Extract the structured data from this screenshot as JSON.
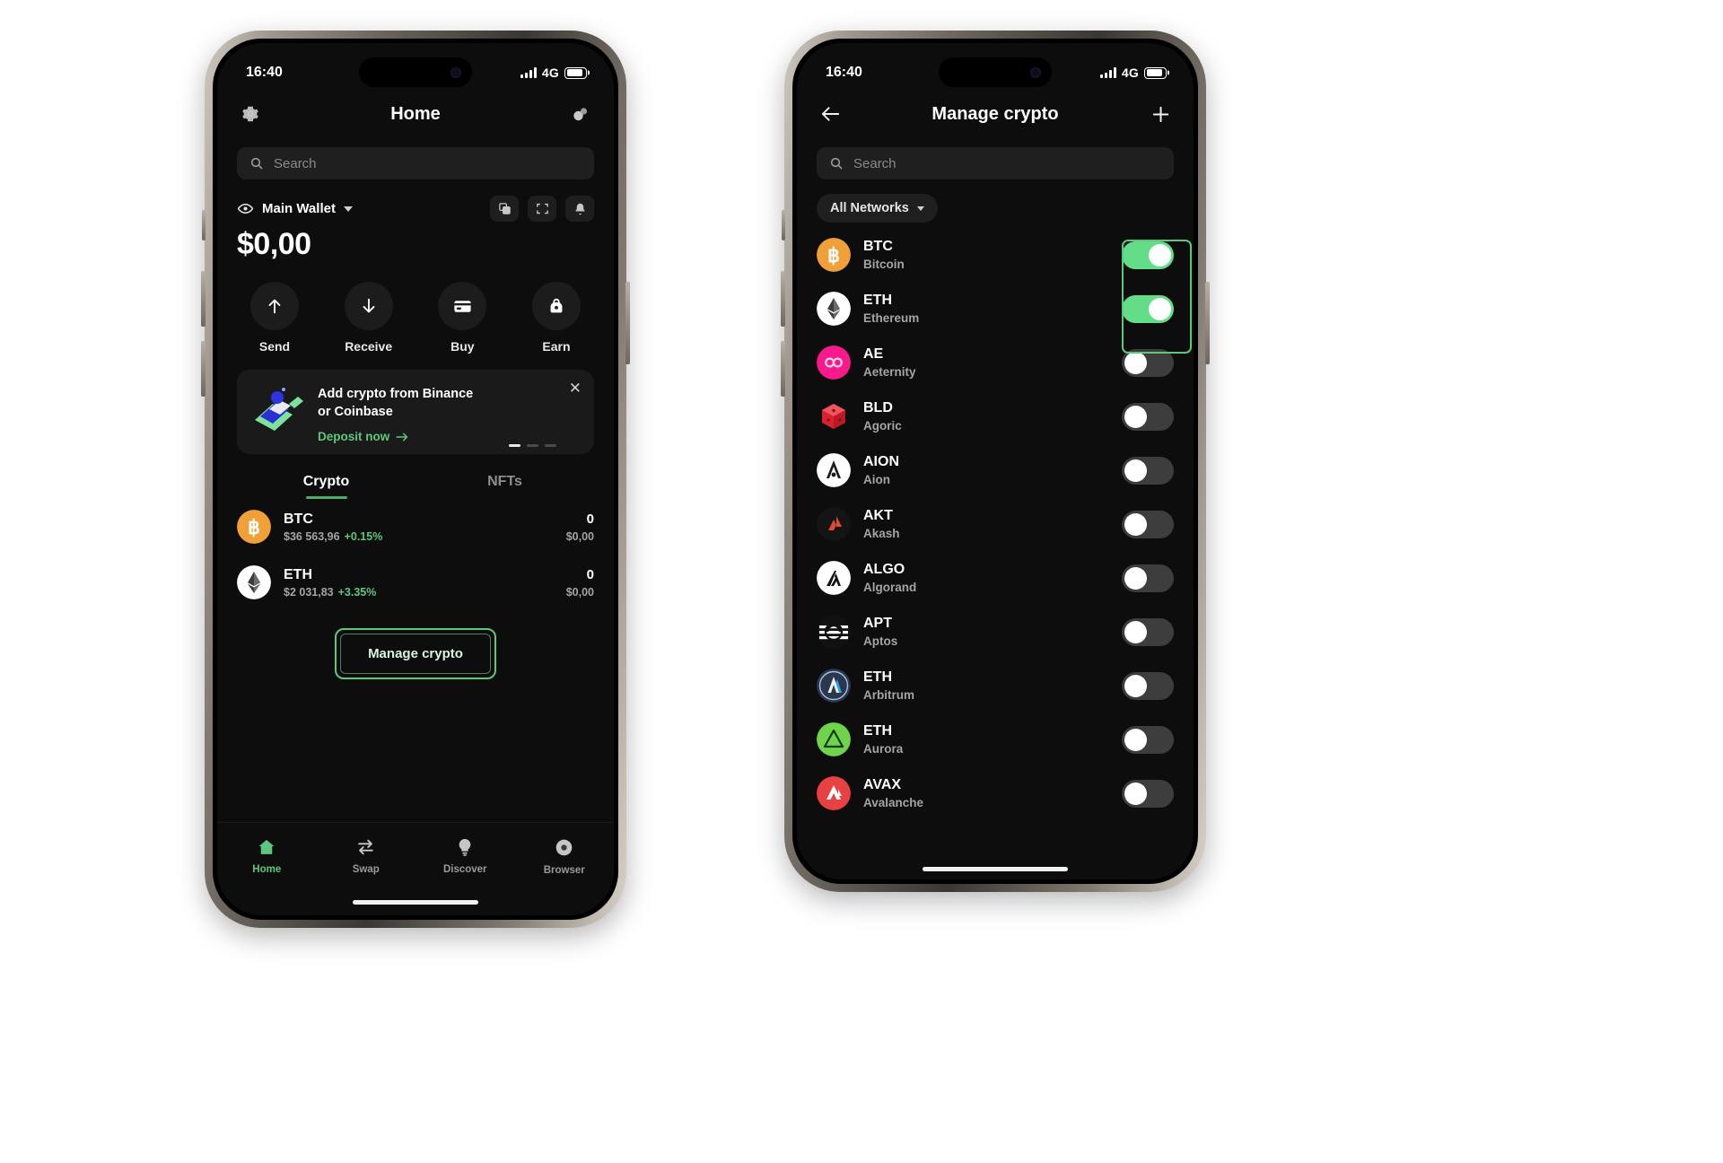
{
  "left_phone": {
    "status": {
      "time": "16:40",
      "network": "4G"
    },
    "header": {
      "title": "Home",
      "settings_icon": "gear-icon",
      "right_icon": "coins-icon"
    },
    "search": {
      "placeholder": "Search",
      "icon": "search-icon"
    },
    "wallet": {
      "eye_icon": "eye-icon",
      "name": "Main Wallet",
      "caret_icon": "chevron-down-icon",
      "balance": "$0,00",
      "actions": [
        {
          "name": "copy-icon"
        },
        {
          "name": "scan-icon"
        },
        {
          "name": "bell-icon"
        }
      ]
    },
    "quick_actions": [
      {
        "label": "Send",
        "icon": "arrow-up-icon"
      },
      {
        "label": "Receive",
        "icon": "arrow-down-icon"
      },
      {
        "label": "Buy",
        "icon": "credit-card-icon"
      },
      {
        "label": "Earn",
        "icon": "earn-icon"
      }
    ],
    "promo": {
      "title_line1": "Add crypto from Binance",
      "title_line2": "or Coinbase",
      "cta": "Deposit now",
      "cta_arrow": "arrow-right-icon",
      "close_icon": "close-icon",
      "dots": 3,
      "active_dot": 0
    },
    "tabs": [
      {
        "label": "Crypto",
        "active": true
      },
      {
        "label": "NFTs",
        "active": false
      }
    ],
    "assets": [
      {
        "symbol": "BTC",
        "price": "$36 563,96",
        "change": "+0.15%",
        "amount": "0",
        "value": "$0,00",
        "icon": "btc-icon",
        "color": "#f0a038"
      },
      {
        "symbol": "ETH",
        "price": "$2 031,83",
        "change": "+3.35%",
        "amount": "0",
        "value": "$0,00",
        "icon": "eth-icon",
        "color": "#ffffff"
      }
    ],
    "manage_button": "Manage crypto",
    "bottom_nav": [
      {
        "label": "Home",
        "icon": "home-icon",
        "active": true
      },
      {
        "label": "Swap",
        "icon": "swap-icon",
        "active": false
      },
      {
        "label": "Discover",
        "icon": "bulb-icon",
        "active": false
      },
      {
        "label": "Browser",
        "icon": "browser-icon",
        "active": false
      }
    ]
  },
  "right_phone": {
    "status": {
      "time": "16:40",
      "network": "4G"
    },
    "header": {
      "title": "Manage crypto",
      "back_icon": "arrow-left-icon",
      "add_icon": "plus-icon"
    },
    "search": {
      "placeholder": "Search",
      "icon": "search-icon"
    },
    "filter": {
      "label": "All Networks",
      "caret_icon": "chevron-down-icon"
    },
    "coins": [
      {
        "symbol": "BTC",
        "name": "Bitcoin",
        "enabled": true,
        "icon": "btc-icon",
        "color": "#f0a038"
      },
      {
        "symbol": "ETH",
        "name": "Ethereum",
        "enabled": true,
        "icon": "eth-icon",
        "color": "#ffffff"
      },
      {
        "symbol": "AE",
        "name": "Aeternity",
        "enabled": false,
        "icon": "aeternity-icon",
        "color": "#f8198a"
      },
      {
        "symbol": "BLD",
        "name": "Agoric",
        "enabled": false,
        "icon": "agoric-icon",
        "color": "#d8232f"
      },
      {
        "symbol": "AION",
        "name": "Aion",
        "enabled": false,
        "icon": "aion-icon",
        "color": "#ffffff"
      },
      {
        "symbol": "AKT",
        "name": "Akash",
        "enabled": false,
        "icon": "akash-icon",
        "color": "#131313"
      },
      {
        "symbol": "ALGO",
        "name": "Algorand",
        "enabled": false,
        "icon": "algorand-icon",
        "color": "#ffffff"
      },
      {
        "symbol": "APT",
        "name": "Aptos",
        "enabled": false,
        "icon": "aptos-icon",
        "color": "#131313"
      },
      {
        "symbol": "ETH",
        "name": "Arbitrum",
        "enabled": false,
        "icon": "arbitrum-icon",
        "color": "#2d374b"
      },
      {
        "symbol": "ETH",
        "name": "Aurora",
        "enabled": false,
        "icon": "aurora-icon",
        "color": "#70d44b"
      },
      {
        "symbol": "AVAX",
        "name": "Avalanche",
        "enabled": false,
        "icon": "avalanche-icon",
        "color": "#e84142"
      }
    ],
    "highlight_color": "#5ec77f"
  },
  "accent": {
    "green": "#5ec77f",
    "toggle_on": "#63dd87",
    "background": "#0d0d0d"
  }
}
